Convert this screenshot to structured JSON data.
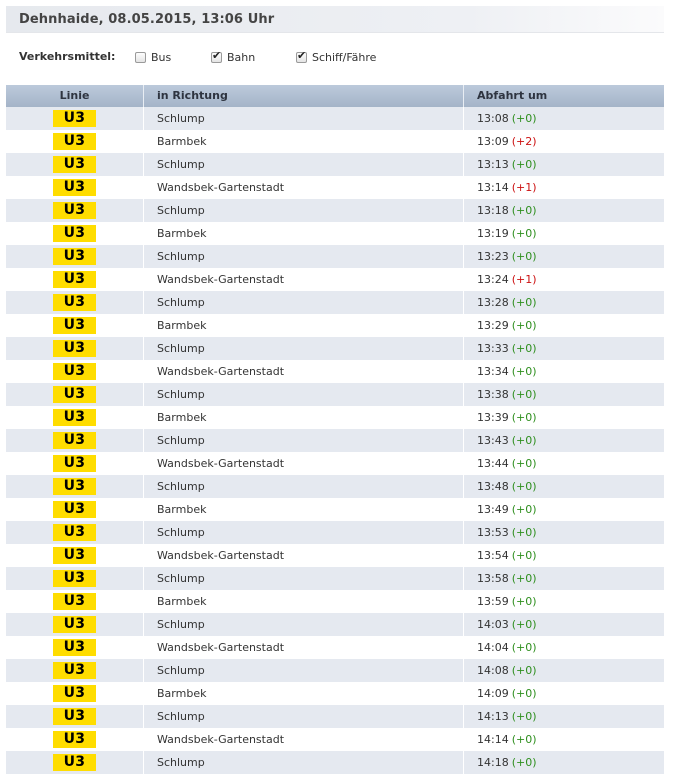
{
  "header": {
    "title": "Dehnhaide, 08.05.2015, 13:06 Uhr"
  },
  "filters": {
    "label": "Verkehrsmittel:",
    "options": [
      {
        "label": "Bus",
        "checked": false
      },
      {
        "label": "Bahn",
        "checked": true
      },
      {
        "label": "Schiff/Fähre",
        "checked": true
      }
    ]
  },
  "table": {
    "columns": [
      "Linie",
      "in Richtung",
      "Abfahrt um"
    ],
    "rows": [
      {
        "line": "U3",
        "direction": "Schlump",
        "time": "13:08",
        "delay": "(+0)"
      },
      {
        "line": "U3",
        "direction": "Barmbek",
        "time": "13:09",
        "delay": "(+2)"
      },
      {
        "line": "U3",
        "direction": "Schlump",
        "time": "13:13",
        "delay": "(+0)"
      },
      {
        "line": "U3",
        "direction": "Wandsbek-Gartenstadt",
        "time": "13:14",
        "delay": "(+1)"
      },
      {
        "line": "U3",
        "direction": "Schlump",
        "time": "13:18",
        "delay": "(+0)"
      },
      {
        "line": "U3",
        "direction": "Barmbek",
        "time": "13:19",
        "delay": "(+0)"
      },
      {
        "line": "U3",
        "direction": "Schlump",
        "time": "13:23",
        "delay": "(+0)"
      },
      {
        "line": "U3",
        "direction": "Wandsbek-Gartenstadt",
        "time": "13:24",
        "delay": "(+1)"
      },
      {
        "line": "U3",
        "direction": "Schlump",
        "time": "13:28",
        "delay": "(+0)"
      },
      {
        "line": "U3",
        "direction": "Barmbek",
        "time": "13:29",
        "delay": "(+0)"
      },
      {
        "line": "U3",
        "direction": "Schlump",
        "time": "13:33",
        "delay": "(+0)"
      },
      {
        "line": "U3",
        "direction": "Wandsbek-Gartenstadt",
        "time": "13:34",
        "delay": "(+0)"
      },
      {
        "line": "U3",
        "direction": "Schlump",
        "time": "13:38",
        "delay": "(+0)"
      },
      {
        "line": "U3",
        "direction": "Barmbek",
        "time": "13:39",
        "delay": "(+0)"
      },
      {
        "line": "U3",
        "direction": "Schlump",
        "time": "13:43",
        "delay": "(+0)"
      },
      {
        "line": "U3",
        "direction": "Wandsbek-Gartenstadt",
        "time": "13:44",
        "delay": "(+0)"
      },
      {
        "line": "U3",
        "direction": "Schlump",
        "time": "13:48",
        "delay": "(+0)"
      },
      {
        "line": "U3",
        "direction": "Barmbek",
        "time": "13:49",
        "delay": "(+0)"
      },
      {
        "line": "U3",
        "direction": "Schlump",
        "time": "13:53",
        "delay": "(+0)"
      },
      {
        "line": "U3",
        "direction": "Wandsbek-Gartenstadt",
        "time": "13:54",
        "delay": "(+0)"
      },
      {
        "line": "U3",
        "direction": "Schlump",
        "time": "13:58",
        "delay": "(+0)"
      },
      {
        "line": "U3",
        "direction": "Barmbek",
        "time": "13:59",
        "delay": "(+0)"
      },
      {
        "line": "U3",
        "direction": "Schlump",
        "time": "14:03",
        "delay": "(+0)"
      },
      {
        "line": "U3",
        "direction": "Wandsbek-Gartenstadt",
        "time": "14:04",
        "delay": "(+0)"
      },
      {
        "line": "U3",
        "direction": "Schlump",
        "time": "14:08",
        "delay": "(+0)"
      },
      {
        "line": "U3",
        "direction": "Barmbek",
        "time": "14:09",
        "delay": "(+0)"
      },
      {
        "line": "U3",
        "direction": "Schlump",
        "time": "14:13",
        "delay": "(+0)"
      },
      {
        "line": "U3",
        "direction": "Wandsbek-Gartenstadt",
        "time": "14:14",
        "delay": "(+0)"
      },
      {
        "line": "U3",
        "direction": "Schlump",
        "time": "14:18",
        "delay": "(+0)"
      }
    ]
  },
  "colors": {
    "line_badge": "#ffdd00",
    "delay_on_time": "#2f8f1f",
    "delay_late": "#cc1111",
    "row_alt": "#e5e9f0",
    "header_bg": "#b0bfd2"
  }
}
